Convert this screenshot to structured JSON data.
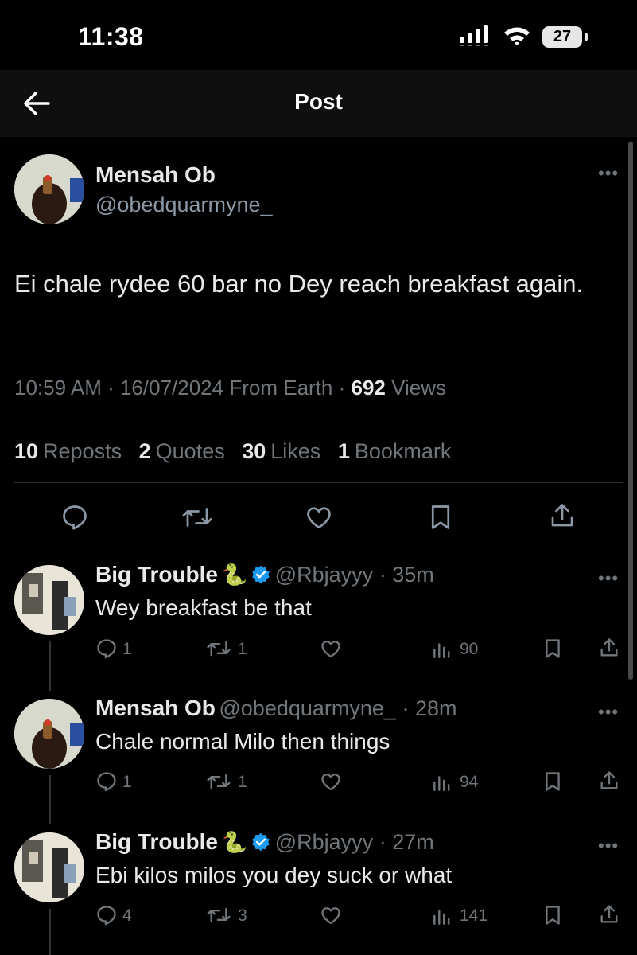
{
  "status_bar": {
    "time": "11:38",
    "battery": "27"
  },
  "header": {
    "title": "Post"
  },
  "post": {
    "author_name": "Mensah Ob",
    "author_handle": "@obedquarmyne_",
    "text": "Ei chale rydee 60 bar no Dey reach breakfast again.",
    "time": "10:59 AM",
    "date": "16/07/2024",
    "source": "From Earth",
    "views": "692",
    "views_label": "Views",
    "stats": [
      {
        "count": "10",
        "label": "Reposts"
      },
      {
        "count": "2",
        "label": "Quotes"
      },
      {
        "count": "30",
        "label": "Likes"
      },
      {
        "count": "1",
        "label": "Bookmark"
      }
    ]
  },
  "replies": [
    {
      "name": "Big Trouble",
      "emoji": "🐍",
      "verified": true,
      "handle": "@Rbjayyy",
      "age": "35m",
      "text": "Wey breakfast be that",
      "replies": "1",
      "reposts": "1",
      "views": "90"
    },
    {
      "name": "Mensah Ob",
      "emoji": "",
      "verified": false,
      "handle": "@obedquarmyne_",
      "age": "28m",
      "text": "Chale normal Milo then things",
      "replies": "1",
      "reposts": "1",
      "views": "94"
    },
    {
      "name": "Big Trouble",
      "emoji": "🐍",
      "verified": true,
      "handle": "@Rbjayyy",
      "age": "27m",
      "text": "Ebi kilos milos you dey suck or what",
      "replies": "4",
      "reposts": "3",
      "views": "141"
    }
  ],
  "icons": {
    "back": "arrow-left-icon",
    "more": "more-icon",
    "reply": "reply-icon",
    "repost": "repost-icon",
    "like": "heart-icon",
    "bookmark": "bookmark-icon",
    "share": "share-icon",
    "views": "views-icon",
    "verified": "verified-badge-icon"
  },
  "colors": {
    "background": "#000000",
    "text": "#e7e9ea",
    "muted": "#71767b",
    "verified": "#1d9bf0"
  }
}
